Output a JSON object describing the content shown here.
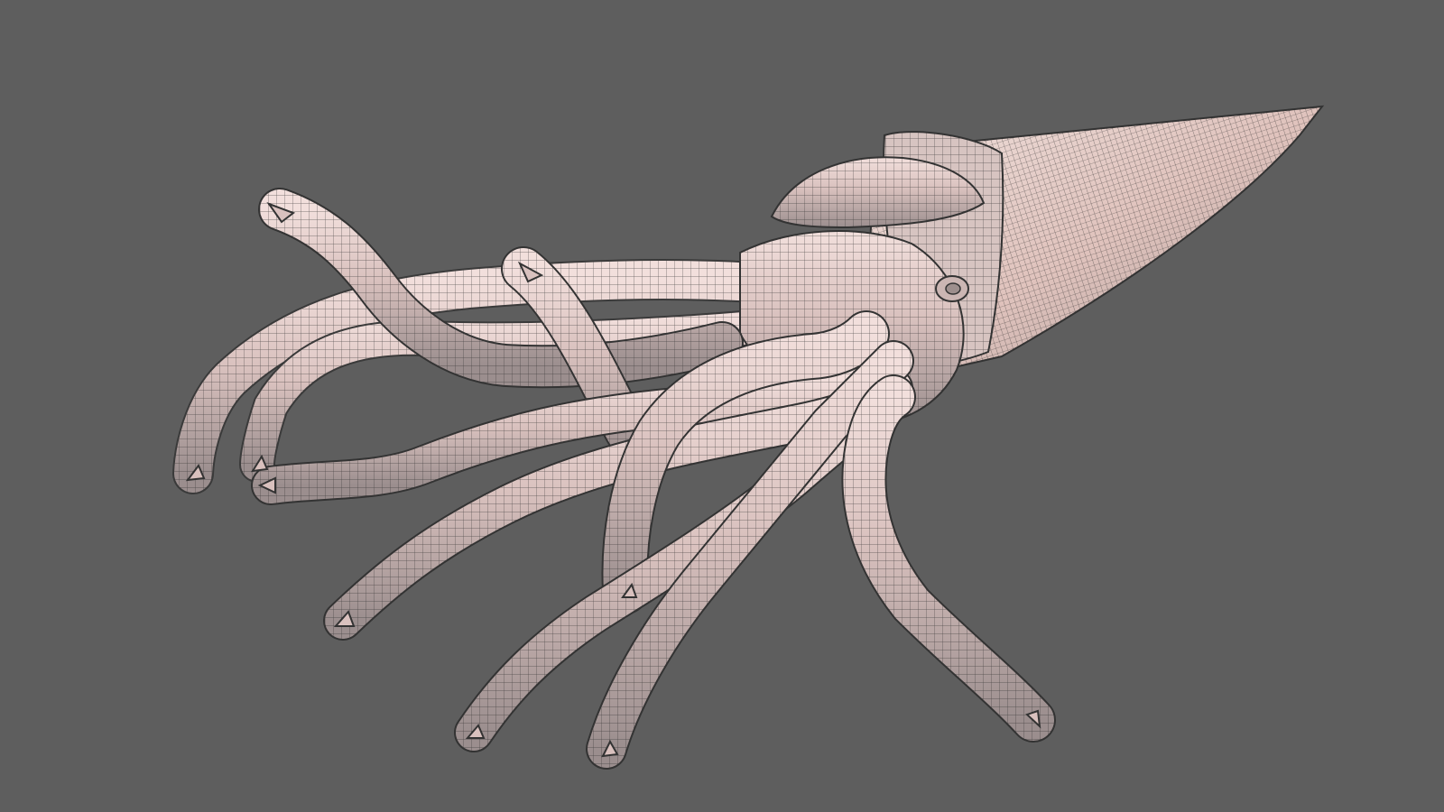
{
  "viewport": {
    "background_color": "#5e5e5e",
    "display_mode": "wireframe-on-shaded",
    "shading": "matcap-clay"
  },
  "model": {
    "subject": "squid",
    "parts": [
      "mantle",
      "fins",
      "head",
      "eye",
      "arms",
      "tentacles"
    ],
    "surface_color": "#d9c2c0",
    "wire_color": "#2b2b2b"
  }
}
